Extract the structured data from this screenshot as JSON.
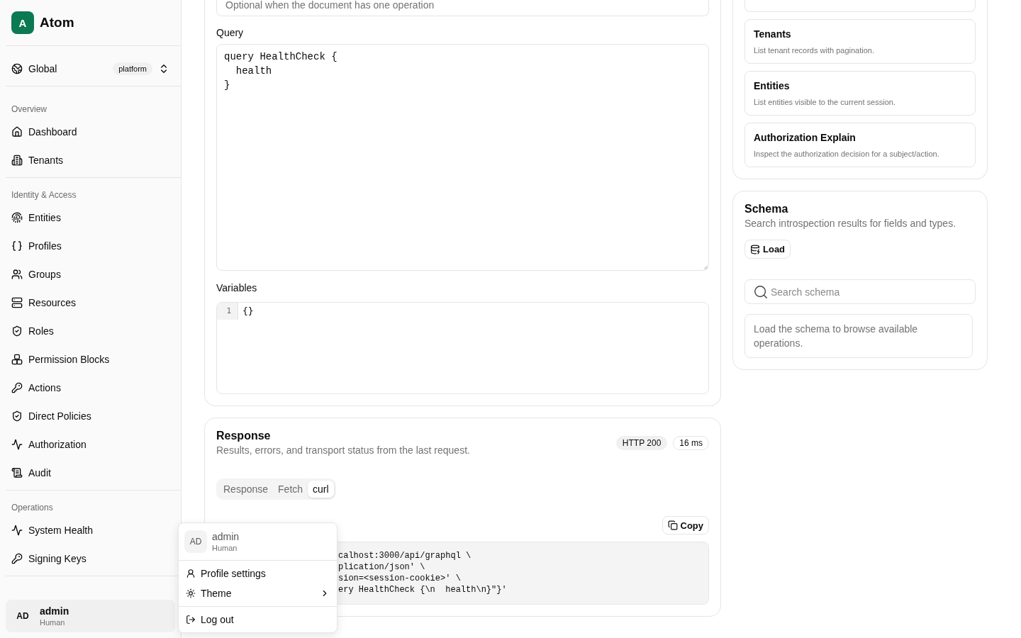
{
  "sidebar": {
    "brand": {
      "initial": "A",
      "name": "Atom"
    },
    "scope": {
      "label": "Global",
      "badge": "platform"
    },
    "groups": [
      {
        "label": "Overview",
        "items": [
          "Dashboard",
          "Tenants"
        ]
      },
      {
        "label": "Identity & Access",
        "items": [
          "Entities",
          "Profiles",
          "Groups",
          "Resources",
          "Roles",
          "Permission Blocks",
          "Actions",
          "Direct Policies",
          "Authorization",
          "Audit"
        ]
      },
      {
        "label": "Operations",
        "items": [
          "System Health",
          "Signing Keys"
        ]
      }
    ],
    "user": {
      "initials": "AD",
      "name": "admin",
      "type": "Human"
    }
  },
  "request": {
    "operation_name": {
      "placeholder": "Optional when the document has one operation"
    },
    "query": {
      "label": "Query",
      "value": "query HealthCheck {\n  health\n}"
    },
    "variables": {
      "label": "Variables",
      "lines": [
        {
          "number": "1",
          "text": "{}"
        }
      ]
    }
  },
  "response": {
    "title": "Response",
    "subtitle": "Results, errors, and transport status from the last request.",
    "status": "HTTP 200",
    "duration": "16 ms",
    "tabs": [
      {
        "label": "Response",
        "selected": false
      },
      {
        "label": "Fetch",
        "selected": false
      },
      {
        "label": "curl",
        "selected": true
      }
    ],
    "copy": "Copy",
    "code_lines": [
      "calhost:3000/api/graphql \\",
      "plication/json' \\",
      "sion=<session-cookie>' \\",
      "ery HealthCheck {\\n  health\\n}\"}'"
    ]
  },
  "examples": {
    "items": [
      {
        "title": "Tenants",
        "description": "List tenant records with pagination."
      },
      {
        "title": "Entities",
        "description": "List entities visible to the current session."
      },
      {
        "title": "Authorization Explain",
        "description": "Inspect the authorization decision for a subject/action."
      }
    ]
  },
  "schema": {
    "title": "Schema",
    "subtitle": "Search introspection results for fields and types.",
    "load": "Load",
    "search": {
      "placeholder": "Search schema"
    },
    "empty": "Load the schema to browse available operations."
  },
  "user_menu": {
    "initials": "AD",
    "name": "admin",
    "type": "Human",
    "sections": [
      {
        "items": [
          {
            "label": "Profile settings",
            "submenu": false
          },
          {
            "label": "Theme",
            "submenu": true
          }
        ]
      },
      {
        "items": [
          {
            "label": "Log out",
            "submenu": false
          }
        ]
      }
    ]
  }
}
